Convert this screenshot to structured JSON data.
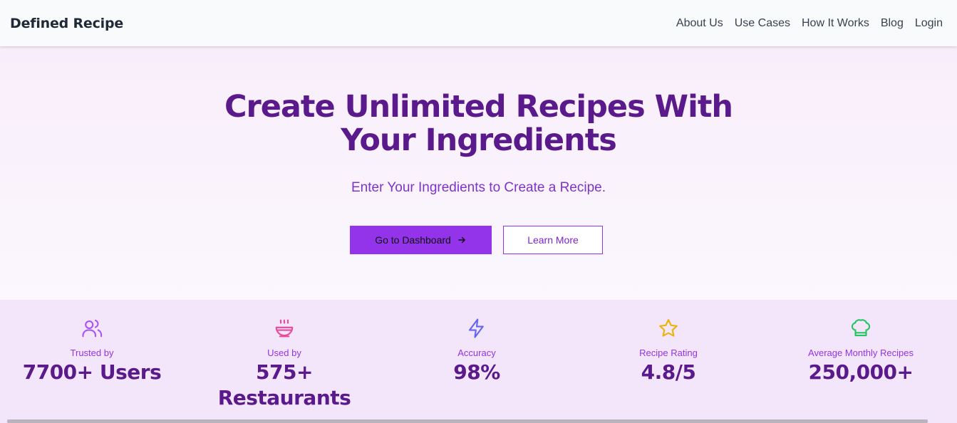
{
  "navbar": {
    "brand": "Defined Recipe",
    "links": [
      "About Us",
      "Use Cases",
      "How It Works",
      "Blog",
      "Login"
    ]
  },
  "hero": {
    "title_line1": "Create Unlimited Recipes With",
    "title_line2": "Your Ingredients",
    "subtitle": "Enter Your Ingredients to Create a Recipe.",
    "primary_button": "Go to Dashboard",
    "secondary_button": "Learn More"
  },
  "stats": [
    {
      "icon": "users-icon",
      "label": "Trusted by",
      "value": "7700+ Users",
      "color": "#a855f7"
    },
    {
      "icon": "soup-bowl-icon",
      "label": "Used by",
      "value": "575+ Restaurants",
      "color": "#ec4899"
    },
    {
      "icon": "lightning-icon",
      "label": "Accuracy",
      "value": "98%",
      "color": "#6366f1"
    },
    {
      "icon": "star-icon",
      "label": "Recipe Rating",
      "value": "4.8/5",
      "color": "#eab308"
    },
    {
      "icon": "chef-hat-icon",
      "label": "Average Monthly Recipes",
      "value": "250,000+",
      "color": "#22c55e"
    }
  ],
  "colors": {
    "accent": "#9333ea",
    "heading": "#5b1a8c",
    "stats_bg": "#f3e6fb"
  }
}
